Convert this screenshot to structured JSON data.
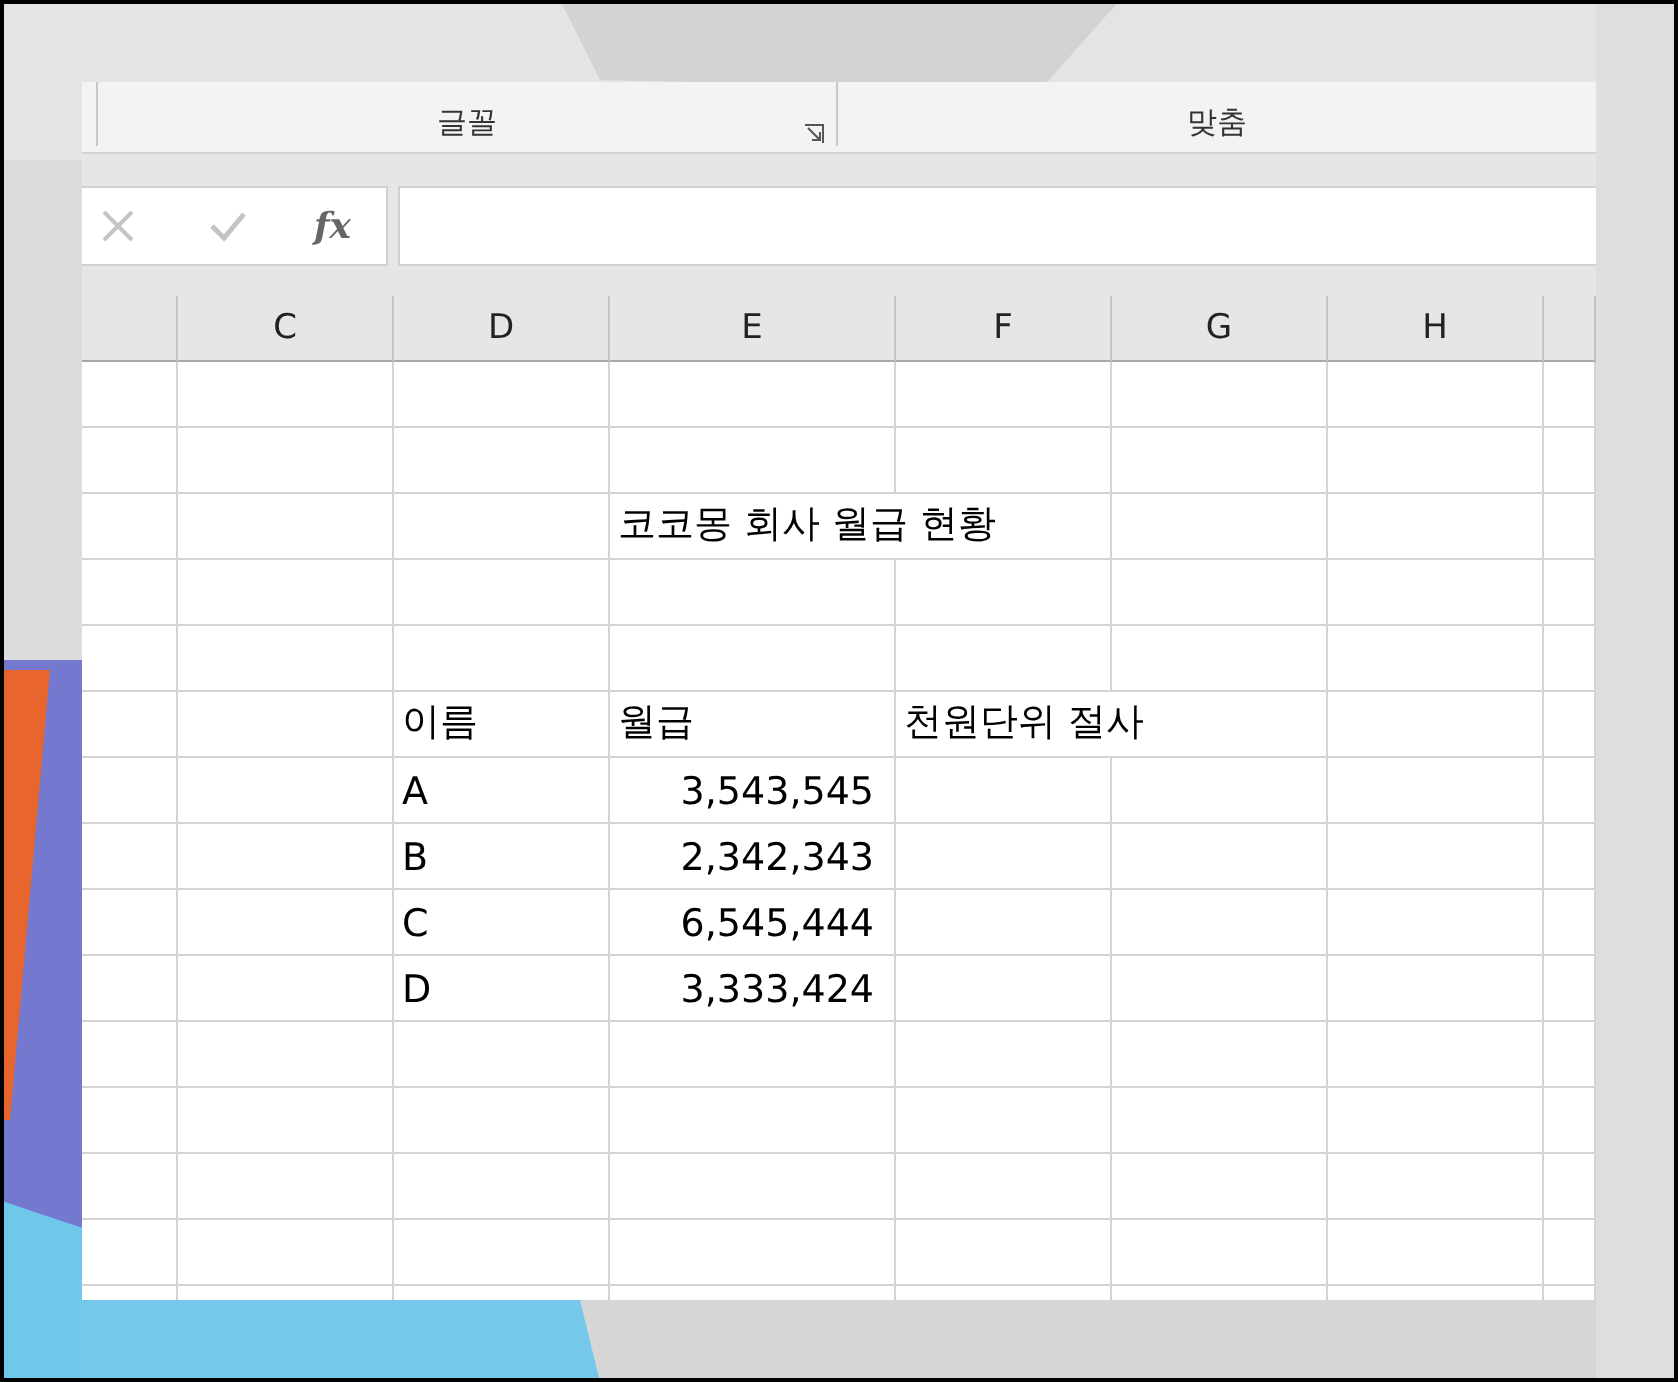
{
  "ribbon": {
    "groups": [
      {
        "label": "글꼴",
        "launcher": true
      },
      {
        "label": "맞춤"
      }
    ]
  },
  "formula_bar": {
    "function_label": "fx"
  },
  "sheet": {
    "columns": [
      "C",
      "D",
      "E",
      "F",
      "G",
      "H"
    ],
    "title": "코코몽 회사 월급 현황",
    "headers": [
      "이름",
      "월급",
      "천원단위 절사"
    ],
    "rows": [
      {
        "name": "A",
        "salary": "3,543,545"
      },
      {
        "name": "B",
        "salary": "2,342,343"
      },
      {
        "name": "C",
        "salary": "6,545,444"
      },
      {
        "name": "D",
        "salary": "3,333,424"
      }
    ]
  }
}
